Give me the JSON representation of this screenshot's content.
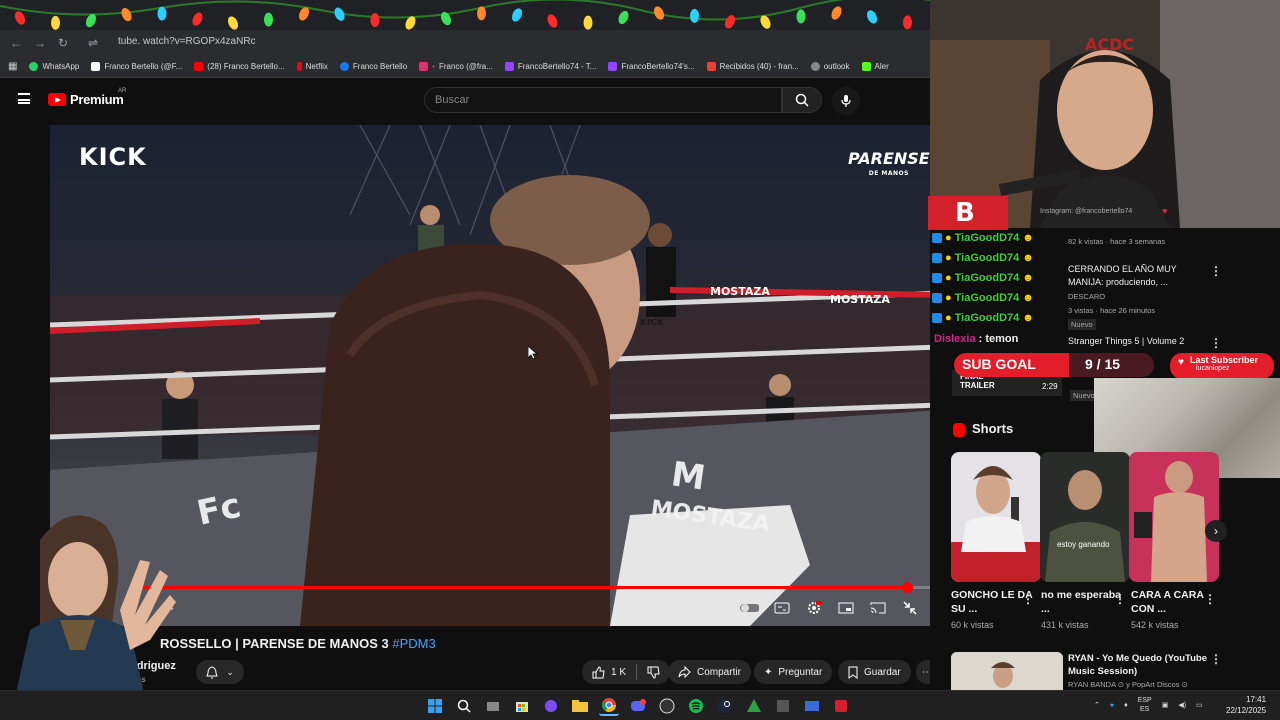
{
  "browser": {
    "url": "tube.   watch?v=RGOPx4zaNRc",
    "bookmarks": [
      {
        "label": "WhatsApp",
        "color": "#25d366"
      },
      {
        "label": "Franco Bertello (@F...",
        "color": "#ffffff"
      },
      {
        "label": "(28) Franco Bertello...",
        "color": "#ff0000"
      },
      {
        "label": "Netflix",
        "color": "#e50914"
      },
      {
        "label": "Franco Bertello",
        "color": "#1877f2"
      },
      {
        "label": "Franco (@fra...",
        "color": "#e1306c"
      },
      {
        "label": "FrancoBertello74 - T...",
        "color": "#9146ff"
      },
      {
        "label": "FrancoBertello74's...",
        "color": "#9146ff"
      },
      {
        "label": "Recibidos (40) - fran...",
        "color": "#ea4335"
      },
      {
        "label": "outlook",
        "color": "#888888"
      },
      {
        "label": "Aler",
        "color": "#53fc18"
      }
    ]
  },
  "header": {
    "logo": "Premium",
    "logo_region": "AR",
    "search_placeholder": "Buscar"
  },
  "video": {
    "brand_left": "KICK",
    "brand_right": "PARENSE",
    "brand_right_sub": "DE MANOS",
    "progress": 0.968,
    "time_fragment": "4",
    "title": "ROSSELLO | PARENSE DE MANOS 3",
    "title_tag": "#PDM3",
    "channel": "odriguez",
    "channel_sub": "ores",
    "likes": "1 K",
    "share": "Compartir",
    "ask": "Preguntar",
    "save": "Guardar"
  },
  "overlay": {
    "instagram": "Instagram: @francobertello74",
    "chat_user": "TiaGoodD74",
    "chat_lines": 5,
    "dislexia_user": "Dislexia",
    "dislexia_msg": "temon",
    "sub_goal_label": "SUB GOAL",
    "sub_goal_value": "9 / 15",
    "last_sub_label": "Last Subscriber",
    "last_sub_name": "lucanlopez"
  },
  "sidebar": {
    "recs": [
      {
        "title": "",
        "meta": "82 k vistas · hace 3 semanas"
      },
      {
        "title": "CERRANDO EL AÑO MUY MANIJA: produciendo, ...",
        "channel": "DESCARO",
        "meta": "3 vistas · hace 26 minutos",
        "badge": "Nuevo"
      },
      {
        "title": "Stranger Things 5 | Volume 2",
        "thumb_label": "FINAL TRAILER",
        "duration": "2:29",
        "badge": "Nuevo"
      }
    ],
    "shorts_header": "Shorts",
    "shorts": [
      {
        "title": "GONCHO LE DA SU ...",
        "views": "60 k vistas"
      },
      {
        "title": "no me esperaba ...",
        "views": "431 k vistas",
        "overlay": "estoy ganando"
      },
      {
        "title": "CARA A CARA CON ...",
        "views": "542 k vistas"
      }
    ],
    "bottom_rec": {
      "title": "RYAN - Yo Me Quedo (YouTube Music Session)",
      "channel": "RYAN BANDA ⊙ y PopArt Discos ⊙"
    }
  },
  "taskbar": {
    "lang_top": "ESP",
    "lang_bottom": "ES",
    "time": "17:41",
    "date": "22/12/2025"
  }
}
